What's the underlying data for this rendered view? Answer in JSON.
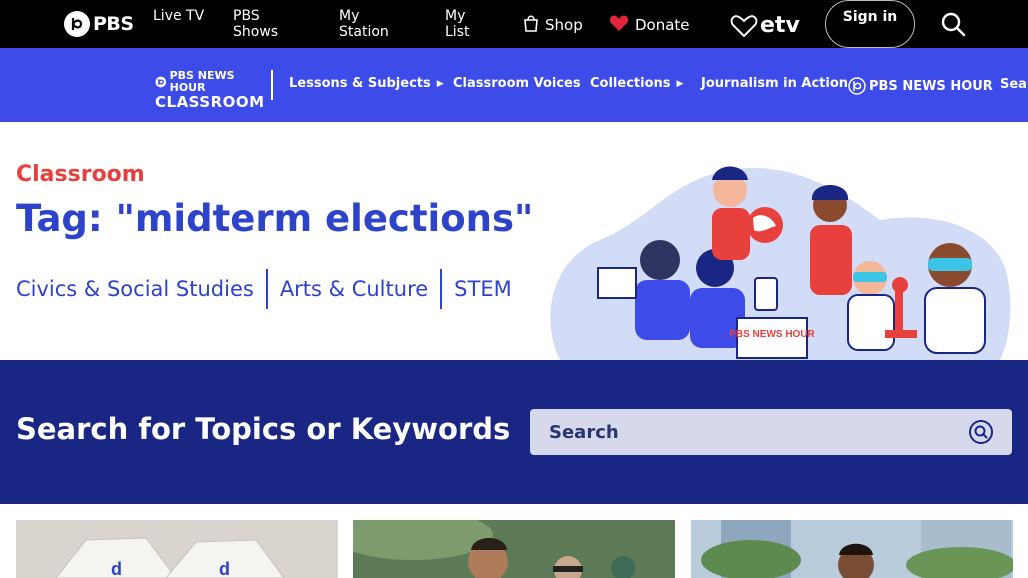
{
  "pbs_bar": {
    "logo_text": "PBS",
    "nav": [
      {
        "label": "Live TV"
      },
      {
        "label": "PBS Shows"
      },
      {
        "label": "My Station"
      },
      {
        "label": "My List"
      }
    ],
    "shop_label": "Shop",
    "donate_label": "Donate",
    "station_logo": "etv",
    "signin_label": "Sign in",
    "icons": {
      "shop": "shopping-bag-icon",
      "donate": "heart-icon",
      "search": "search-icon"
    },
    "colors": {
      "background": "#000000",
      "donate_heart": "#e5243b"
    }
  },
  "newshour_bar": {
    "logo_line1": "PBS NEWS HOUR",
    "logo_line2": "CLASSROOM",
    "items": [
      {
        "label": "Lessons & Subjects",
        "has_caret": true
      },
      {
        "label": "Classroom Voices",
        "has_caret": false
      },
      {
        "label": "Collections",
        "has_caret": true
      },
      {
        "label": "Journalism in Action",
        "has_caret": false
      }
    ],
    "brand_label": "PBS NEWS HOUR",
    "search_label": "Sear",
    "colors": {
      "background": "#3d4ce8"
    }
  },
  "hero": {
    "kicker": "Classroom",
    "title": "Tag: \"midterm elections\"",
    "subjects": [
      "Civics & Social Studies",
      "Arts & Culture",
      "STEM"
    ],
    "illustration": "students-illustration",
    "illustration_sign": "PBS NEWS HOUR",
    "colors": {
      "kicker": "#e8403d",
      "title": "#2d43c9"
    }
  },
  "search_band": {
    "heading": "Search for Topics or Keywords",
    "placeholder": "Search",
    "icon": "search-icon",
    "colors": {
      "background": "#1a2683",
      "input": "#d6d9ec"
    }
  },
  "cards": [
    {
      "image": "ballot-boxes-photo"
    },
    {
      "image": "people-outdoors-photo"
    },
    {
      "image": "man-city-street-photo"
    }
  ]
}
